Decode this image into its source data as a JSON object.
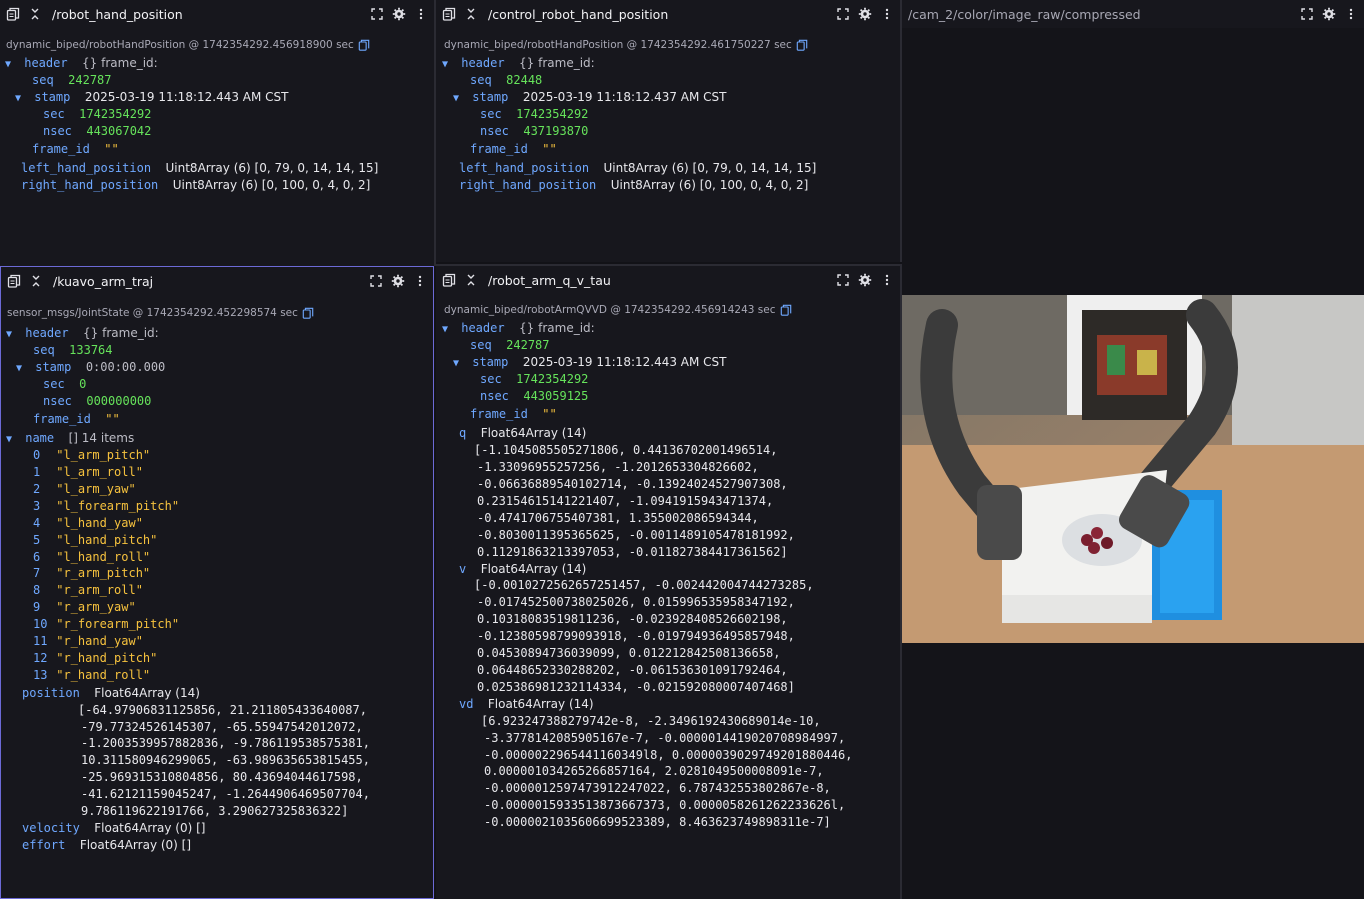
{
  "panels": {
    "p1": {
      "title": "/robot_hand_position",
      "meta": "dynamic_biped/robotHandPosition @ 1742354292.456918900 sec",
      "header_key": "header",
      "header_hint": "{} frame_id:",
      "seq_key": "seq",
      "seq_val": "242787",
      "stamp_key": "stamp",
      "stamp_val": "2025-03-19 11:18:12.443 AM CST",
      "sec_key": "sec",
      "sec_val": "1742354292",
      "nsec_key": "nsec",
      "nsec_val": "443067042",
      "frame_key": "frame_id",
      "frame_val": "\"\"",
      "lhp_key": "left_hand_position",
      "lhp_val": "Uint8Array (6) [0, 79, 0, 14, 14, 15]",
      "rhp_key": "right_hand_position",
      "rhp_val": "Uint8Array (6) [0, 100, 0, 4, 0, 2]"
    },
    "p2": {
      "title": "/control_robot_hand_position",
      "meta": "dynamic_biped/robotHandPosition @ 1742354292.461750227 sec",
      "header_key": "header",
      "header_hint": "{} frame_id:",
      "seq_key": "seq",
      "seq_val": "82448",
      "stamp_key": "stamp",
      "stamp_val": "2025-03-19 11:18:12.437 AM CST",
      "sec_key": "sec",
      "sec_val": "1742354292",
      "nsec_key": "nsec",
      "nsec_val": "437193870",
      "frame_key": "frame_id",
      "frame_val": "\"\"",
      "lhp_key": "left_hand_position",
      "lhp_val": "Uint8Array (6) [0, 79, 0, 14, 14, 15]",
      "rhp_key": "right_hand_position",
      "rhp_val": "Uint8Array (6) [0, 100, 0, 4, 0, 2]"
    },
    "p3": {
      "title": "/cam_2/color/image_raw/compressed"
    },
    "p4": {
      "title": "/kuavo_arm_traj",
      "meta": "sensor_msgs/JointState @ 1742354292.452298574 sec",
      "header_key": "header",
      "header_hint": "{} frame_id:",
      "seq_key": "seq",
      "seq_val": "133764",
      "stamp_key": "stamp",
      "stamp_val": "0:00:00.000",
      "sec_key": "sec",
      "sec_val": "0",
      "nsec_key": "nsec",
      "nsec_val": "000000000",
      "frame_key": "frame_id",
      "frame_val": "\"\"",
      "name_key": "name",
      "name_hint": "[] 14 items",
      "names": [
        "\"l_arm_pitch\"",
        "\"l_arm_roll\"",
        "\"l_arm_yaw\"",
        "\"l_forearm_pitch\"",
        "\"l_hand_yaw\"",
        "\"l_hand_pitch\"",
        "\"l_hand_roll\"",
        "\"r_arm_pitch\"",
        "\"r_arm_roll\"",
        "\"r_arm_yaw\"",
        "\"r_forearm_pitch\"",
        "\"r_hand_yaw\"",
        "\"r_hand_pitch\"",
        "\"r_hand_roll\""
      ],
      "position_key": "position",
      "position_type": "Float64Array (14)",
      "position_lines": [
        "[-64.97906831125856, 21.211805433640087,",
        "-79.77324526145307, -65.55947542012072,",
        "-1.2003539957882836, -9.786119538575381,",
        "10.311580946299065, -63.989635653815455,",
        "-25.969315310804856, 80.43694044617598,",
        "-41.62121159045247, -1.2644906469507704,",
        "9.786119622191766, 3.290627325836322]"
      ],
      "velocity_key": "velocity",
      "velocity_val": "Float64Array (0) []",
      "effort_key": "effort",
      "effort_val": "Float64Array (0) []"
    },
    "p5": {
      "title": "/robot_arm_q_v_tau",
      "meta": "dynamic_biped/robotArmQVVD @ 1742354292.456914243 sec",
      "header_key": "header",
      "header_hint": "{} frame_id:",
      "seq_key": "seq",
      "seq_val": "242787",
      "stamp_key": "stamp",
      "stamp_val": "2025-03-19 11:18:12.443 AM CST",
      "sec_key": "sec",
      "sec_val": "1742354292",
      "nsec_key": "nsec",
      "nsec_val": "443059125",
      "frame_key": "frame_id",
      "frame_val": "\"\"",
      "q_key": "q",
      "q_type": "Float64Array (14)",
      "q_lines": [
        "[-1.1045085505271806, 0.44136702001496514,",
        "-1.33096955257256, -1.2012653304826602,",
        "-0.06636889540102714, -0.13924024527907308,",
        "0.23154615141221407, -1.0941915943471374,",
        "-0.4741706755407381, 1.355002086594344,",
        "-0.8030011395365625, -0.0011489105478181992,",
        "0.11291863213397053, -0.011827384417361562]"
      ],
      "v_key": "v",
      "v_type": "Float64Array (14)",
      "v_lines": [
        "[-0.0010272562657251457, -0.002442004744273285,",
        "-0.017452500738025026, 0.015996535958347192,",
        "0.10318083519811236, -0.023928408526602198,",
        "-0.12380598799093918, -0.019794936495857948,",
        "0.04530894736039099, 0.012212842508136658,",
        "0.06448652330288202, -0.061536301091792464,",
        "0.025386981232114334, -0.021592080007407468]"
      ],
      "vd_key": "vd",
      "vd_type": "Float64Array (14)",
      "vd_lines": [
        "[6.923247388279742e-8, -2.3496192430689014e-10,",
        "-3.3778142085905167e-7, -0.0000014419020708984997,",
        "-0.0000022965441160349l8, 0.0000039029749201880446,",
        "0.000001034265266857164, 2.0281049500008091e-7,",
        "-0.0000012597473912247022, 6.787432553802867e-8,",
        "-0.0000015933513873667373, 0.0000058261262233626l,",
        "-0.0000021035606699523389, 8.463623749898311e-7]"
      ]
    }
  }
}
